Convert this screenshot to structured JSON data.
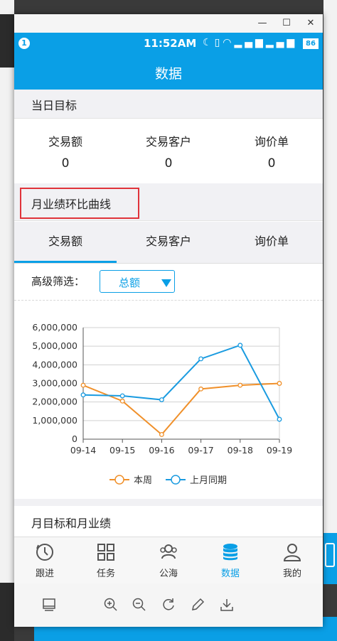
{
  "window_controls": {
    "minimize": "—",
    "maximize": "☐",
    "close": "✕"
  },
  "statusbar": {
    "badge": "1",
    "time": "11:52AM",
    "battery": "86"
  },
  "appbar": {
    "title": "数据"
  },
  "daily_target": {
    "title": "当日目标",
    "stats": [
      {
        "label": "交易额",
        "value": "0"
      },
      {
        "label": "交易客户",
        "value": "0"
      },
      {
        "label": "询价单",
        "value": "0"
      }
    ]
  },
  "monthly_curve": {
    "title": "月业绩环比曲线",
    "tabs": [
      "交易额",
      "交易客户",
      "询价单"
    ],
    "active_tab": 0,
    "filter_label": "高级筛选：",
    "filter_value": "总额"
  },
  "chart_data": {
    "type": "line",
    "x": [
      "09-14",
      "09-15",
      "09-16",
      "09-17",
      "09-18",
      "09-19"
    ],
    "series": [
      {
        "name": "本周",
        "color": "#f0902a",
        "values": [
          2900000,
          2050000,
          250000,
          2700000,
          2900000,
          3000000
        ]
      },
      {
        "name": "上月同期",
        "color": "#1a9be0",
        "values": [
          2380000,
          2330000,
          2120000,
          4320000,
          5050000,
          1070000
        ]
      }
    ],
    "ylim": [
      0,
      6000000
    ],
    "yticks": [
      "0",
      "1,000,000",
      "2,000,000",
      "3,000,000",
      "4,000,000",
      "5,000,000",
      "6,000,000"
    ],
    "grid": true,
    "legend": "bottom-center"
  },
  "month_target": {
    "title": "月目标和月业绩"
  },
  "bottom_nav": [
    {
      "label": "跟进",
      "icon": "clock-icon"
    },
    {
      "label": "任务",
      "icon": "grid-icon"
    },
    {
      "label": "公海",
      "icon": "users-icon"
    },
    {
      "label": "数据",
      "icon": "database-icon"
    },
    {
      "label": "我的",
      "icon": "person-icon"
    }
  ],
  "active_nav": 3,
  "colors": {
    "accent": "#0a9fe6",
    "highlight": "#e0333a"
  }
}
